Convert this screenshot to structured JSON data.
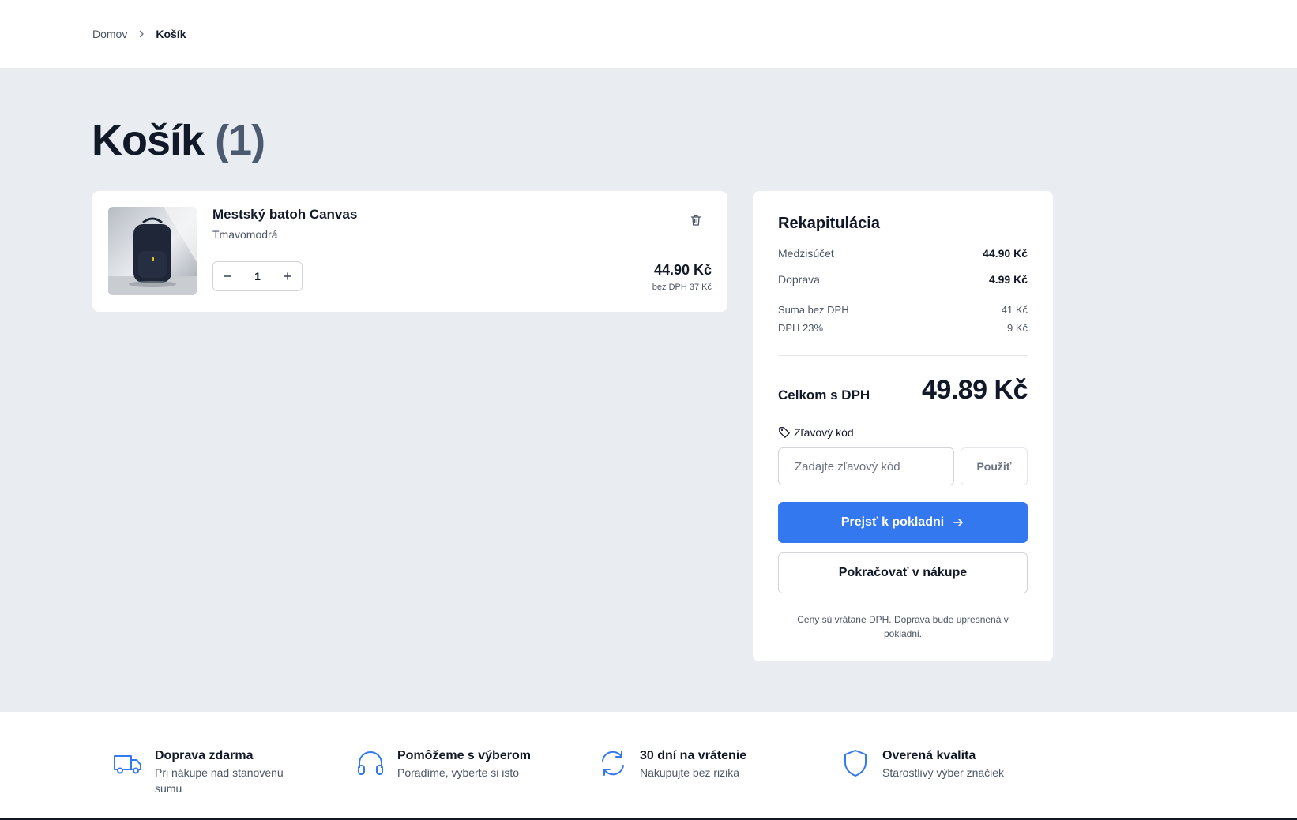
{
  "breadcrumb": {
    "home": "Domov",
    "current": "Košík"
  },
  "page": {
    "title": "Košík",
    "count": "(1)"
  },
  "cart": {
    "items": [
      {
        "name": "Mestský batoh Canvas",
        "variant": "Tmavomodrá",
        "quantity": "1",
        "price": "44.90 Kč",
        "price_net": "bez DPH 37 Kč",
        "image_icon": "backpack-photo"
      }
    ]
  },
  "summary": {
    "title": "Rekapitulácia",
    "subtotal_label": "Medzisúčet",
    "subtotal_value": "44.90 Kč",
    "shipping_label": "Doprava",
    "shipping_value": "4.99 Kč",
    "net_label": "Suma bez DPH",
    "net_value": "41 Kč",
    "vat_label": "DPH 23%",
    "vat_value": "9 Kč",
    "total_label": "Celkom s DPH",
    "total_value": "49.89 Kč",
    "coupon_label": "Zľavový kód",
    "coupon_placeholder": "Zadajte zľavový kód",
    "coupon_button": "Použiť",
    "checkout_button": "Prejsť k pokladni",
    "continue_button": "Pokračovať v nákupe",
    "note": "Ceny sú vrátane DPH. Doprava bude upresnená v pokladni."
  },
  "features": [
    {
      "icon": "truck-icon",
      "title": "Doprava zdarma",
      "subtitle": "Pri nákupe nad stanovenú sumu"
    },
    {
      "icon": "headphones-icon",
      "title": "Pomôžeme s výberom",
      "subtitle": "Poradíme, vyberte si isto"
    },
    {
      "icon": "refresh-icon",
      "title": "30 dní na vrátenie",
      "subtitle": "Nakupujte bez rizika"
    },
    {
      "icon": "shield-icon",
      "title": "Overená kvalita",
      "subtitle": "Starostlivý výber značiek"
    }
  ],
  "colors": {
    "accent": "#3478f0",
    "background": "#e9ecf1",
    "text": "#111827"
  }
}
